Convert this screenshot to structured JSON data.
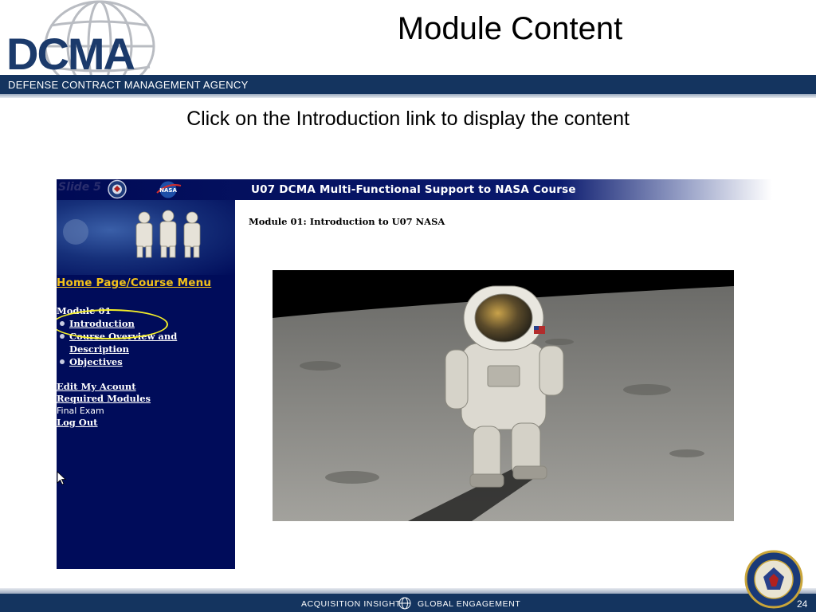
{
  "slide": {
    "logo": "DCMA",
    "title": "Module Content",
    "agency": "DEFENSE CONTRACT MANAGEMENT AGENCY",
    "instruction": "Click on the Introduction link to display the content",
    "footer_left": "ACQUISITION INSIGHT",
    "footer_right": "GLOBAL ENGAGEMENT",
    "page_number": "24",
    "colors": {
      "navy": "#14345f",
      "logo_blue": "#1b3a6b"
    }
  },
  "screenshot": {
    "slide_label": "Slide 5",
    "nasa_logo": "NASA",
    "course_title": "U07 DCMA Multi-Functional Support to NASA Course",
    "sidebar": {
      "home_link": "Home Page/Course Menu",
      "module_heading": "Module 01",
      "items": [
        {
          "label": "Introduction"
        },
        {
          "label": "Course Overview and Description"
        },
        {
          "label": "Objectives"
        }
      ],
      "account_links": {
        "edit_account": "Edit My Acount",
        "required_modules": "Required Modules",
        "final_exam": "Final Exam",
        "log_out": "Log Out"
      }
    },
    "content": {
      "module_heading": "Module 01: Introduction to U07 NASA"
    },
    "colors": {
      "sidebar_bg": "#000c5a",
      "home_link": "#f3c21a",
      "highlight_ring": "#f4ef28"
    },
    "icons": [
      "dcma-seal-icon",
      "nasa-logo-icon",
      "cursor-arrow-icon"
    ]
  }
}
